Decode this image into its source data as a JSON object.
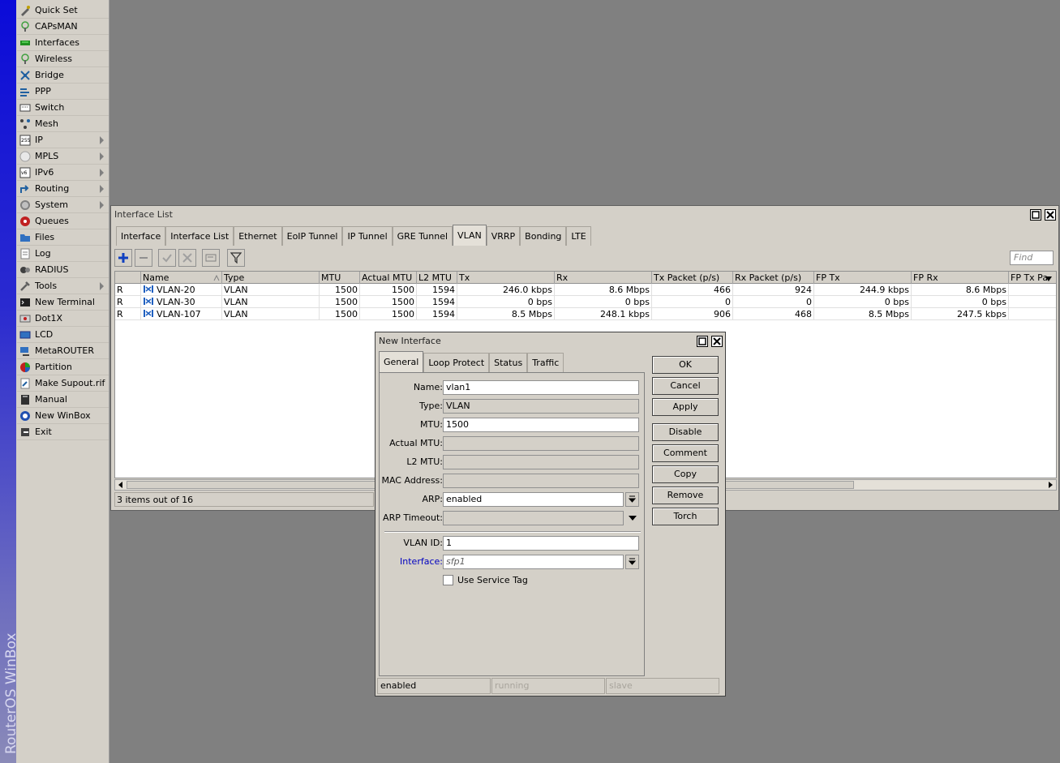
{
  "brand": {
    "text": "RouterOS WinBox"
  },
  "sidebar": {
    "items": [
      {
        "label": "Quick Set",
        "icon": "quick-set-icon",
        "submenu": false
      },
      {
        "label": "CAPsMAN",
        "icon": "capsman-icon",
        "submenu": false
      },
      {
        "label": "Interfaces",
        "icon": "interfaces-icon",
        "submenu": false
      },
      {
        "label": "Wireless",
        "icon": "wireless-icon",
        "submenu": false
      },
      {
        "label": "Bridge",
        "icon": "bridge-icon",
        "submenu": false
      },
      {
        "label": "PPP",
        "icon": "ppp-icon",
        "submenu": false
      },
      {
        "label": "Switch",
        "icon": "switch-icon",
        "submenu": false
      },
      {
        "label": "Mesh",
        "icon": "mesh-icon",
        "submenu": false
      },
      {
        "label": "IP",
        "icon": "ip-icon",
        "submenu": true
      },
      {
        "label": "MPLS",
        "icon": "mpls-icon",
        "submenu": true
      },
      {
        "label": "IPv6",
        "icon": "ipv6-icon",
        "submenu": true
      },
      {
        "label": "Routing",
        "icon": "routing-icon",
        "submenu": true
      },
      {
        "label": "System",
        "icon": "system-icon",
        "submenu": true
      },
      {
        "label": "Queues",
        "icon": "queues-icon",
        "submenu": false
      },
      {
        "label": "Files",
        "icon": "files-icon",
        "submenu": false
      },
      {
        "label": "Log",
        "icon": "log-icon",
        "submenu": false
      },
      {
        "label": "RADIUS",
        "icon": "radius-icon",
        "submenu": false
      },
      {
        "label": "Tools",
        "icon": "tools-icon",
        "submenu": true
      },
      {
        "label": "New Terminal",
        "icon": "terminal-icon",
        "submenu": false
      },
      {
        "label": "Dot1X",
        "icon": "dot1x-icon",
        "submenu": false
      },
      {
        "label": "LCD",
        "icon": "lcd-icon",
        "submenu": false
      },
      {
        "label": "MetaROUTER",
        "icon": "metarouter-icon",
        "submenu": false
      },
      {
        "label": "Partition",
        "icon": "partition-icon",
        "submenu": false
      },
      {
        "label": "Make Supout.rif",
        "icon": "supout-icon",
        "submenu": false
      },
      {
        "label": "Manual",
        "icon": "manual-icon",
        "submenu": false
      },
      {
        "label": "New WinBox",
        "icon": "winbox-icon",
        "submenu": false
      },
      {
        "label": "Exit",
        "icon": "exit-icon",
        "submenu": false
      }
    ]
  },
  "interface_list": {
    "title": "Interface List",
    "tabs": [
      "Interface",
      "Interface List",
      "Ethernet",
      "EoIP Tunnel",
      "IP Tunnel",
      "GRE Tunnel",
      "VLAN",
      "VRRP",
      "Bonding",
      "LTE"
    ],
    "active_tab": "VLAN",
    "find_placeholder": "Find",
    "columns": [
      "",
      "Name",
      "Type",
      "MTU",
      "Actual MTU",
      "L2 MTU",
      "Tx",
      "Rx",
      "Tx Packet (p/s)",
      "Rx Packet (p/s)",
      "FP Tx",
      "FP Rx",
      "FP Tx Pa"
    ],
    "rows": [
      {
        "flag": "R",
        "name": "VLAN-20",
        "type": "VLAN",
        "mtu": "1500",
        "actual_mtu": "1500",
        "l2_mtu": "1594",
        "tx": "246.0 kbps",
        "rx": "8.6 Mbps",
        "tx_pps": "466",
        "rx_pps": "924",
        "fp_tx": "244.9 kbps",
        "fp_rx": "8.6 Mbps"
      },
      {
        "flag": "R",
        "name": "VLAN-30",
        "type": "VLAN",
        "mtu": "1500",
        "actual_mtu": "1500",
        "l2_mtu": "1594",
        "tx": "0 bps",
        "rx": "0 bps",
        "tx_pps": "0",
        "rx_pps": "0",
        "fp_tx": "0 bps",
        "fp_rx": "0 bps"
      },
      {
        "flag": "R",
        "name": "VLAN-107",
        "type": "VLAN",
        "mtu": "1500",
        "actual_mtu": "1500",
        "l2_mtu": "1594",
        "tx": "8.5 Mbps",
        "rx": "248.1 kbps",
        "tx_pps": "906",
        "rx_pps": "468",
        "fp_tx": "8.5 Mbps",
        "fp_rx": "247.5 kbps"
      }
    ],
    "status": "3 items out of 16"
  },
  "new_interface": {
    "title": "New Interface",
    "tabs": [
      "General",
      "Loop Protect",
      "Status",
      "Traffic"
    ],
    "active_tab": "General",
    "fields": {
      "name": {
        "label": "Name:",
        "value": "vlan1"
      },
      "type": {
        "label": "Type:",
        "value": "VLAN"
      },
      "mtu": {
        "label": "MTU:",
        "value": "1500"
      },
      "actual_mtu": {
        "label": "Actual MTU:",
        "value": ""
      },
      "l2_mtu": {
        "label": "L2 MTU:",
        "value": ""
      },
      "mac_address": {
        "label": "MAC Address:",
        "value": ""
      },
      "arp": {
        "label": "ARP:",
        "value": "enabled"
      },
      "arp_timeout": {
        "label": "ARP Timeout:",
        "value": ""
      },
      "vlan_id": {
        "label": "VLAN ID:",
        "value": "1"
      },
      "interface": {
        "label": "Interface:",
        "value": "sfp1"
      }
    },
    "use_service_tag": {
      "label": "Use Service Tag",
      "checked": false
    },
    "buttons": [
      "OK",
      "Cancel",
      "Apply",
      "Disable",
      "Comment",
      "Copy",
      "Remove",
      "Torch"
    ],
    "status": [
      "enabled",
      "running",
      "slave"
    ]
  }
}
